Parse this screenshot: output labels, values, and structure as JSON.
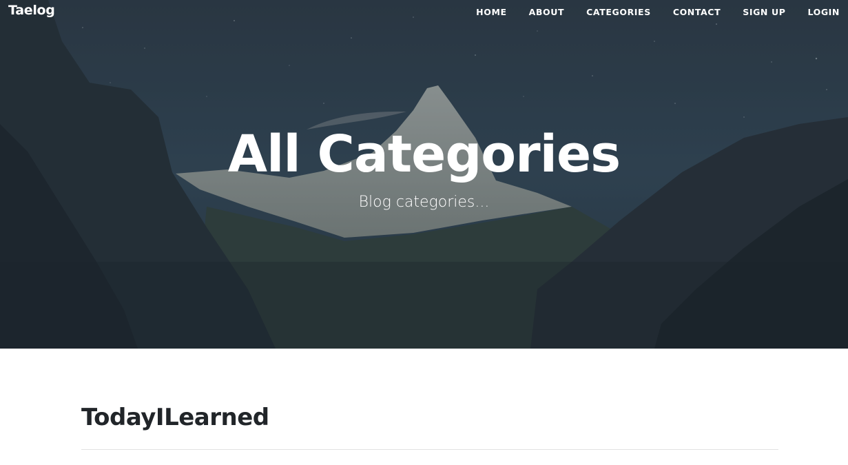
{
  "brand": {
    "name": "Taelog"
  },
  "nav": {
    "home": "HOME",
    "about": "ABOUT",
    "categories": "CATEGORIES",
    "contact": "CONTACT",
    "signup": "SIGN UP",
    "login": "LOGIN"
  },
  "hero": {
    "title": "All Categories",
    "subtitle": "Blog categories..."
  },
  "content": {
    "categories": [
      "TodayILearned"
    ]
  },
  "colors": {
    "hero_overlay": "#2c3a48",
    "heading_text": "#212529",
    "nav_text": "#ffffff",
    "divider": "#e2e2e2"
  }
}
